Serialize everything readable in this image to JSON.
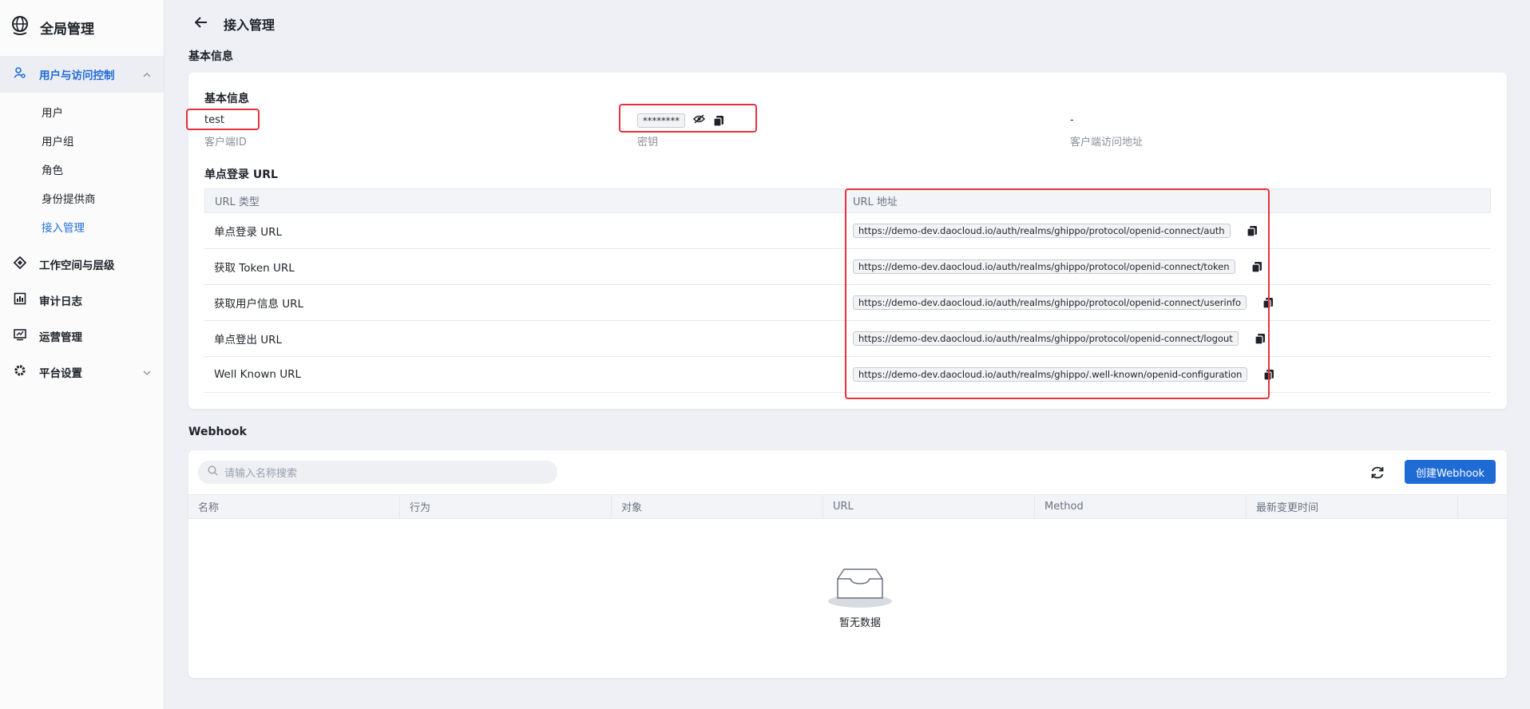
{
  "sidebar": {
    "brand": "全局管理",
    "items": [
      {
        "label": "用户与访问控制",
        "icon": "user-key-icon",
        "active": true,
        "expanded": true
      },
      {
        "label": "工作空间与层级",
        "icon": "workspace-icon"
      },
      {
        "label": "审计日志",
        "icon": "audit-log-icon"
      },
      {
        "label": "运营管理",
        "icon": "operations-chart-icon"
      },
      {
        "label": "平台设置",
        "icon": "gear-icon",
        "collapsible": true
      }
    ],
    "subitems": [
      {
        "label": "用户"
      },
      {
        "label": "用户组"
      },
      {
        "label": "角色"
      },
      {
        "label": "身份提供商"
      },
      {
        "label": "接入管理",
        "active": true
      }
    ]
  },
  "header": {
    "title": "接入管理"
  },
  "basic": {
    "section_title": "基本信息",
    "card_title": "基本信息",
    "client_id": {
      "value": "test",
      "label": "客户端ID"
    },
    "secret": {
      "value": "********",
      "label": "密钥"
    },
    "access_url": {
      "value": "-",
      "label": "客户端访问地址"
    }
  },
  "sso": {
    "title": "单点登录 URL",
    "columns": [
      "URL 类型",
      "URL 地址"
    ],
    "rows": [
      {
        "type": "单点登录 URL",
        "url": "https://demo-dev.daocloud.io/auth/realms/ghippo/protocol/openid-connect/auth"
      },
      {
        "type": "获取 Token URL",
        "url": "https://demo-dev.daocloud.io/auth/realms/ghippo/protocol/openid-connect/token"
      },
      {
        "type": "获取用户信息 URL",
        "url": "https://demo-dev.daocloud.io/auth/realms/ghippo/protocol/openid-connect/userinfo"
      },
      {
        "type": "单点登出 URL",
        "url": "https://demo-dev.daocloud.io/auth/realms/ghippo/protocol/openid-connect/logout"
      },
      {
        "type": "Well Known URL",
        "url": "https://demo-dev.daocloud.io/auth/realms/ghippo/.well-known/openid-configuration"
      }
    ]
  },
  "webhook": {
    "section_title": "Webhook",
    "search_placeholder": "请输入名称搜索",
    "create_button": "创建Webhook",
    "columns": [
      "名称",
      "行为",
      "对象",
      "URL",
      "Method",
      "最新变更时间"
    ],
    "empty_text": "暂无数据"
  },
  "colors": {
    "accent": "#1f6bd6",
    "highlight": "#e5333e"
  }
}
